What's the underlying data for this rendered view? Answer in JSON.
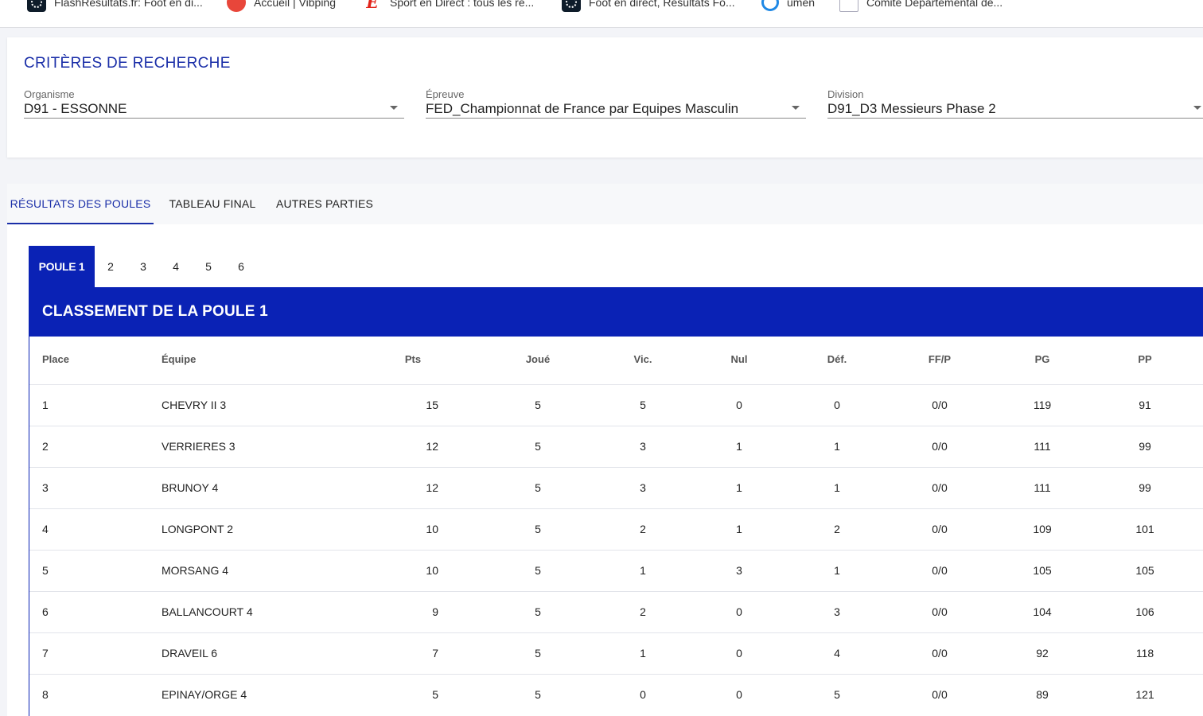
{
  "bookmarks": [
    {
      "label": "FlashResultats.fr: Foot en di...",
      "icon": "flashresultats-icon"
    },
    {
      "label": "Accueil | Vibping",
      "icon": "vibping-icon"
    },
    {
      "label": "Sport en Direct : tous les ré...",
      "icon": "lequipe-icon"
    },
    {
      "label": "Foot en direct, Résultats Fo...",
      "icon": "flashscore-icon"
    },
    {
      "label": "umen",
      "icon": "umen-icon"
    },
    {
      "label": "Comité Départemental de...",
      "icon": "comite-icon"
    }
  ],
  "criteria": {
    "title": "CRITÈRES DE RECHERCHE",
    "organisme": {
      "label": "Organisme",
      "value": "D91 - ESSONNE"
    },
    "epreuve": {
      "label": "Épreuve",
      "value": "FED_Championnat de France par Equipes Masculin"
    },
    "division": {
      "label": "Division",
      "value": "D91_D3 Messieurs Phase 2"
    }
  },
  "tabs": [
    {
      "label": "RÉSULTATS DES POULES",
      "active": true
    },
    {
      "label": "TABLEAU FINAL",
      "active": false
    },
    {
      "label": "AUTRES PARTIES",
      "active": false
    }
  ],
  "poules": [
    "POULE 1",
    "2",
    "3",
    "4",
    "5",
    "6"
  ],
  "ranking": {
    "title": "CLASSEMENT DE LA POULE 1",
    "columns": [
      "Place",
      "Équipe",
      "Pts",
      "Joué",
      "Vic.",
      "Nul",
      "Déf.",
      "FF/P",
      "PG",
      "PP"
    ],
    "rows": [
      [
        "1",
        "CHEVRY II 3",
        "15",
        "5",
        "5",
        "0",
        "0",
        "0/0",
        "119",
        "91"
      ],
      [
        "2",
        "VERRIERES 3",
        "12",
        "5",
        "3",
        "1",
        "1",
        "0/0",
        "111",
        "99"
      ],
      [
        "3",
        "BRUNOY 4",
        "12",
        "5",
        "3",
        "1",
        "1",
        "0/0",
        "111",
        "99"
      ],
      [
        "4",
        "LONGPONT 2",
        "10",
        "5",
        "2",
        "1",
        "2",
        "0/0",
        "109",
        "101"
      ],
      [
        "5",
        "MORSANG 4",
        "10",
        "5",
        "1",
        "3",
        "1",
        "0/0",
        "105",
        "105"
      ],
      [
        "6",
        "BALLANCOURT 4",
        "9",
        "5",
        "2",
        "0",
        "3",
        "0/0",
        "104",
        "106"
      ],
      [
        "7",
        "DRAVEIL 6",
        "7",
        "5",
        "1",
        "0",
        "4",
        "0/0",
        "92",
        "118"
      ],
      [
        "8",
        "EPINAY/ORGE 4",
        "5",
        "5",
        "0",
        "0",
        "5",
        "0/0",
        "89",
        "121"
      ]
    ]
  },
  "colors": {
    "accent": "#0a22b5",
    "title_blue": "#1a2ea8"
  }
}
